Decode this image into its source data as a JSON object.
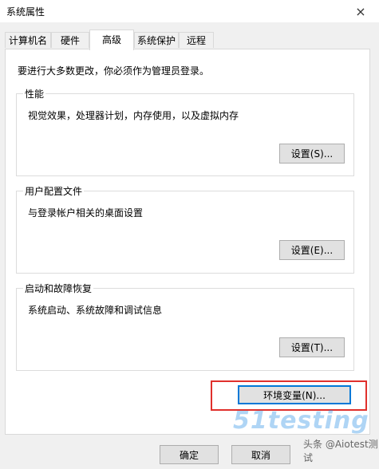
{
  "window": {
    "title": "系统属性",
    "close_glyph": "×"
  },
  "tabs": [
    {
      "label": "计算机名"
    },
    {
      "label": "硬件"
    },
    {
      "label": "高级"
    },
    {
      "label": "系统保护"
    },
    {
      "label": "远程"
    }
  ],
  "admin_note": "要进行大多数更改，你必须作为管理员登录。",
  "groups": {
    "performance": {
      "title": "性能",
      "description": "视觉效果，处理器计划，内存使用，以及虚拟内存",
      "button": "设置(S)..."
    },
    "user_profiles": {
      "title": "用户配置文件",
      "description": "与登录帐户相关的桌面设置",
      "button": "设置(E)..."
    },
    "startup_recovery": {
      "title": "启动和故障恢复",
      "description": "系统启动、系统故障和调试信息",
      "button": "设置(T)..."
    }
  },
  "env_button": "环境变量(N)...",
  "footer": {
    "ok": "确定",
    "cancel": "取消"
  },
  "watermark": {
    "brand": "51testing",
    "sub": "软件测试网",
    "note": "头条 @Aiotest测试"
  }
}
